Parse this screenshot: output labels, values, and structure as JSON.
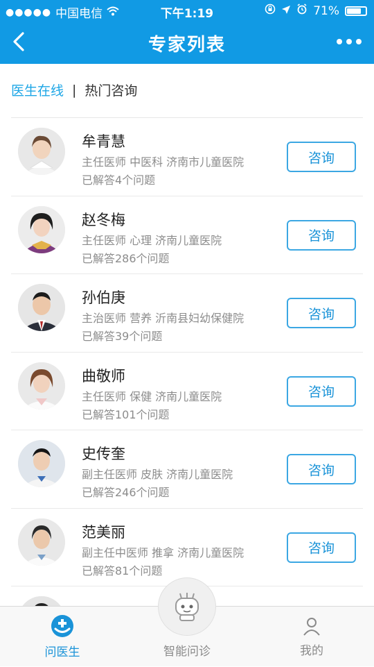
{
  "status": {
    "carrier": "中国电信",
    "time": "下午1:19",
    "battery": "71%"
  },
  "nav": {
    "title": "专家列表"
  },
  "tabs": {
    "active": "医生在线",
    "separator": "|",
    "other": "热门咨询"
  },
  "doctors": [
    {
      "name": "牟青慧",
      "info": "主任医师 中医科 济南市儿童医院",
      "answered": "已解答4个问题",
      "button": "咨询"
    },
    {
      "name": "赵冬梅",
      "info": "主任医师 心理 济南儿童医院",
      "answered": "已解答286个问题",
      "button": "咨询"
    },
    {
      "name": "孙伯庚",
      "info": "主治医师 营养 沂南县妇幼保健院",
      "answered": "已解答39个问题",
      "button": "咨询"
    },
    {
      "name": "曲敬师",
      "info": "主任医师 保健 济南儿童医院",
      "answered": "已解答101个问题",
      "button": "咨询"
    },
    {
      "name": "史传奎",
      "info": "副主任医师 皮肤 济南儿童医院",
      "answered": "已解答246个问题",
      "button": "咨询"
    },
    {
      "name": "范美丽",
      "info": "副主任中医师 推拿 济南儿童医院",
      "answered": "已解答81个问题",
      "button": "咨询"
    },
    {
      "name": "",
      "info": "",
      "answered": "",
      "button": ""
    }
  ],
  "tabbar": {
    "doctor": "问医生",
    "diagnosis": "智能问诊",
    "mine": "我的"
  },
  "colors": {
    "primary": "#119ae4",
    "accent": "#1a93d8"
  }
}
